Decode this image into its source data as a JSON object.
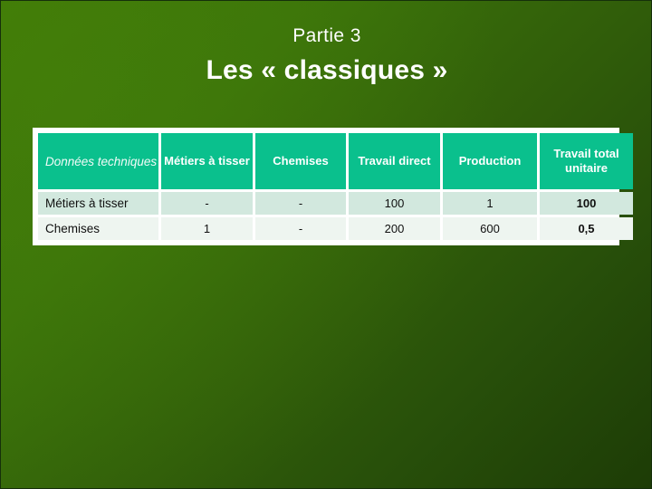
{
  "slide": {
    "section_label": "Partie 3",
    "title": "Les « classiques »",
    "background_color": "#3b730a",
    "background_color_dark": "#1d3c06"
  },
  "table": {
    "header_background": "#0ac08d",
    "header_text_color": "#ffffff",
    "row_a_background": "#d2e8de",
    "row_b_background": "#eef5f0",
    "headers": [
      "Données techniques",
      "Métiers à tisser",
      "Chemises",
      "Travail direct",
      "Production",
      "Travail total unitaire"
    ],
    "rows": [
      {
        "label": "Métiers à tisser",
        "metiers_a_tisser": "-",
        "chemises": "-",
        "travail_direct": "100",
        "production": "1",
        "travail_total_unitaire": "100"
      },
      {
        "label": "Chemises",
        "metiers_a_tisser": "1",
        "chemises": "-",
        "travail_direct": "200",
        "production": "600",
        "travail_total_unitaire": "0,5"
      }
    ]
  }
}
